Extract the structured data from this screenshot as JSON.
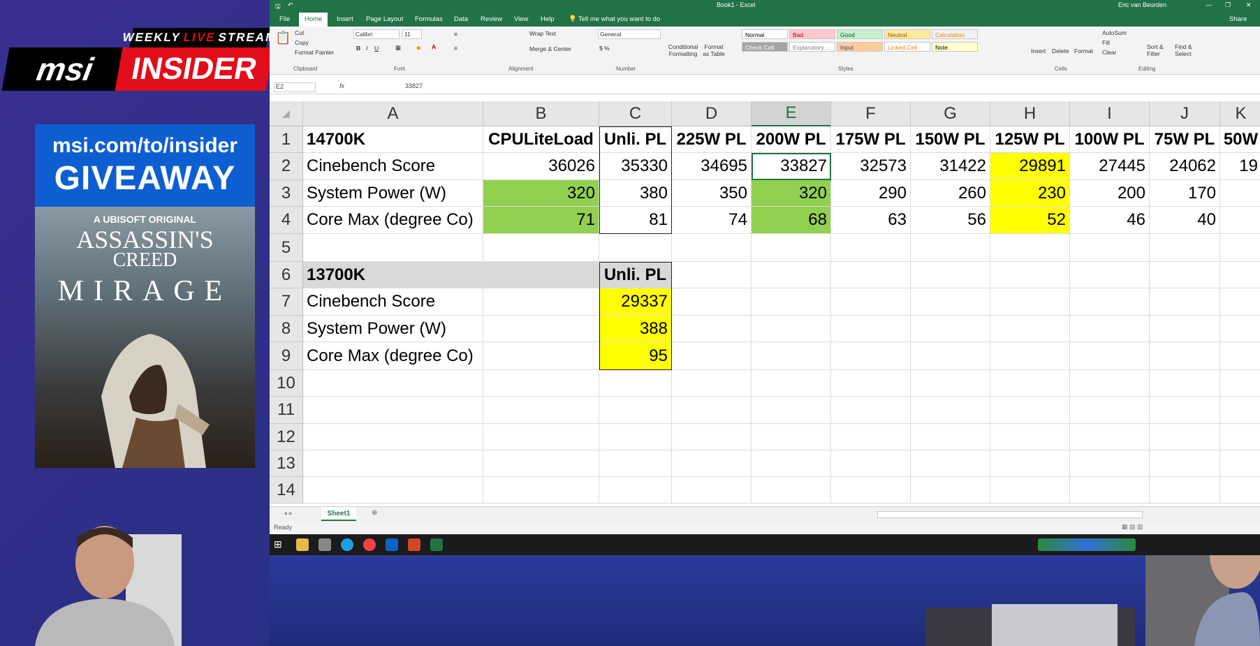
{
  "branding": {
    "weekly_pre": "WEEKLY",
    "weekly_live": "LIVE",
    "weekly_post": "STREAM",
    "msi": "msi",
    "insider": "INSIDER"
  },
  "giveaway": {
    "url": "msi.com/to/insider",
    "title": "GIVEAWAY",
    "ubisoft": "A UBISOFT ORIGINAL",
    "game_title_1": "ASSASSIN'S",
    "game_title_2": "CREED",
    "game_subtitle": "MIRAGE"
  },
  "excel": {
    "app_title": "Book1 - Excel",
    "user_name": "Eric van Beurden",
    "share": "Share",
    "menu": [
      "File",
      "Home",
      "Insert",
      "Page Layout",
      "Formulas",
      "Data",
      "Review",
      "View",
      "Help"
    ],
    "tell_me": "Tell me what you want to do",
    "ribbon": {
      "cut": "Cut",
      "copy": "Copy",
      "format_painter": "Format Painter",
      "clipboard": "Clipboard",
      "font_name": "Calibri",
      "font_size": "11",
      "font": "Font",
      "wrap_text": "Wrap Text",
      "merge_center": "Merge & Center",
      "alignment": "Alignment",
      "number_format": "General",
      "number": "Number",
      "conditional": "Conditional Formatting",
      "format_table": "Format as Table",
      "styles_label": "Styles",
      "styles": [
        {
          "label": "Normal",
          "bg": "#ffffff",
          "fg": "#000000"
        },
        {
          "label": "Bad",
          "bg": "#ffc7ce",
          "fg": "#9c0006"
        },
        {
          "label": "Good",
          "bg": "#c6efce",
          "fg": "#006100"
        },
        {
          "label": "Neutral",
          "bg": "#ffeb9c",
          "fg": "#9c5700"
        },
        {
          "label": "Calculation",
          "bg": "#f2f2f2",
          "fg": "#fa7d00"
        },
        {
          "label": "Check Cell",
          "bg": "#a5a5a5",
          "fg": "#ffffff"
        },
        {
          "label": "Explanatory ...",
          "bg": "#ffffff",
          "fg": "#7f7f7f"
        },
        {
          "label": "Input",
          "bg": "#ffcc99",
          "fg": "#3f3f76"
        },
        {
          "label": "Linked Cell",
          "bg": "#ffffff",
          "fg": "#fa7d00"
        },
        {
          "label": "Note",
          "bg": "#ffffcc",
          "fg": "#000000"
        }
      ],
      "insert": "Insert",
      "delete": "Delete",
      "format": "Format",
      "cells": "Cells",
      "autosum": "AutoSum",
      "fill": "Fill",
      "clear": "Clear",
      "sort_filter": "Sort & Filter",
      "find_select": "Find & Select",
      "editing": "Editing"
    },
    "name_box": "E2",
    "fx": "fx",
    "formula_value": "33827",
    "columns": [
      "A",
      "B",
      "C",
      "D",
      "E",
      "F",
      "G",
      "H",
      "I",
      "J",
      "K"
    ],
    "rows": [
      "1",
      "2",
      "3",
      "4",
      "5",
      "6",
      "7",
      "8",
      "9",
      "10",
      "11",
      "12",
      "13",
      "14"
    ],
    "cells": {
      "A1": "14700K",
      "B1": "CPULiteLoad",
      "C1": "Unli. PL",
      "D1": "225W PL",
      "E1": "200W PL",
      "F1": "175W PL",
      "G1": "150W PL",
      "H1": "125W PL",
      "I1": "100W PL",
      "J1": "75W PL",
      "K1": "50W",
      "A2": "Cinebench Score",
      "B2": "36026",
      "C2": "35330",
      "D2": "34695",
      "E2": "33827",
      "F2": "32573",
      "G2": "31422",
      "H2": "29891",
      "I2": "27445",
      "J2": "24062",
      "K2": "19",
      "A3": "System Power (W)",
      "B3": "320",
      "C3": "380",
      "D3": "350",
      "E3": "320",
      "F3": "290",
      "G3": "260",
      "H3": "230",
      "I3": "200",
      "J3": "170",
      "A4": "Core Max  (degree Co)",
      "B4": "71",
      "C4": "81",
      "D4": "74",
      "E4": "68",
      "F4": "63",
      "G4": "56",
      "H4": "52",
      "I4": "46",
      "J4": "40",
      "A6": "13700K",
      "C6": "Unli. PL",
      "A7": "Cinebench Score",
      "C7": "29337",
      "A8": "System Power (W)",
      "C8": "388",
      "A9": "Core Max  (degree Co)",
      "C9": "95"
    },
    "sheet_tab": "Sheet1",
    "status": "Ready",
    "colors": {
      "excel_green": "#217346",
      "cell_green": "#92d050",
      "cell_yellow": "#ffff00",
      "header_gray": "#d9d9d9"
    }
  }
}
